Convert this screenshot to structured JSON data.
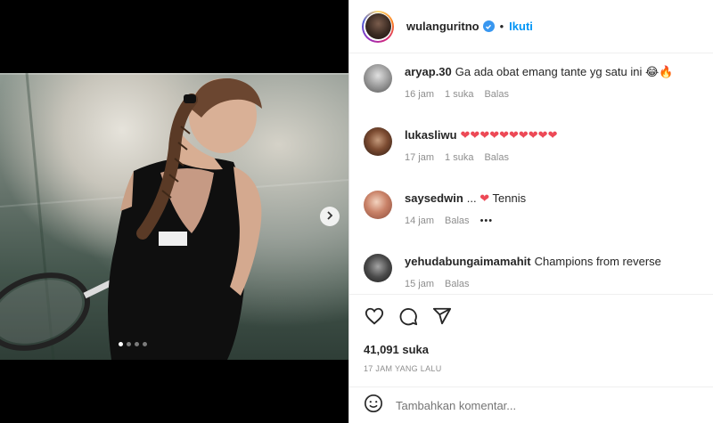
{
  "header": {
    "username": "wulanguritno",
    "separator": "•",
    "follow_label": "Ikuti"
  },
  "media": {
    "slide_count": 4,
    "active_slide": 1
  },
  "comments": [
    {
      "user": "aryap.30",
      "text": "Ga ada obat emang tante yg satu ini 😂🔥",
      "time": "16 jam",
      "likes": "1 suka",
      "reply": "Balas"
    },
    {
      "user": "lukasliwu",
      "text": "❤❤❤❤❤❤❤❤❤❤",
      "time": "17 jam",
      "likes": "1 suka",
      "reply": "Balas"
    },
    {
      "user": "saysedwin",
      "text_prefix": "...",
      "text_heart": "❤",
      "text": "Tennis",
      "time": "14 jam",
      "reply": "Balas",
      "more": "•••"
    },
    {
      "user": "yehudabungaimamahit",
      "text": "Champions from reverse",
      "time": "15 jam",
      "reply": "Balas"
    }
  ],
  "actions": {
    "likes_count": "41,091 suka",
    "timestamp": "17 JAM YANG LALU"
  },
  "add_comment": {
    "placeholder": "Tambahkan komentar..."
  },
  "colors": {
    "accent": "#0095f6",
    "verified": "#3897f0",
    "heart": "#ed4956",
    "muted": "#8e8e8e"
  }
}
